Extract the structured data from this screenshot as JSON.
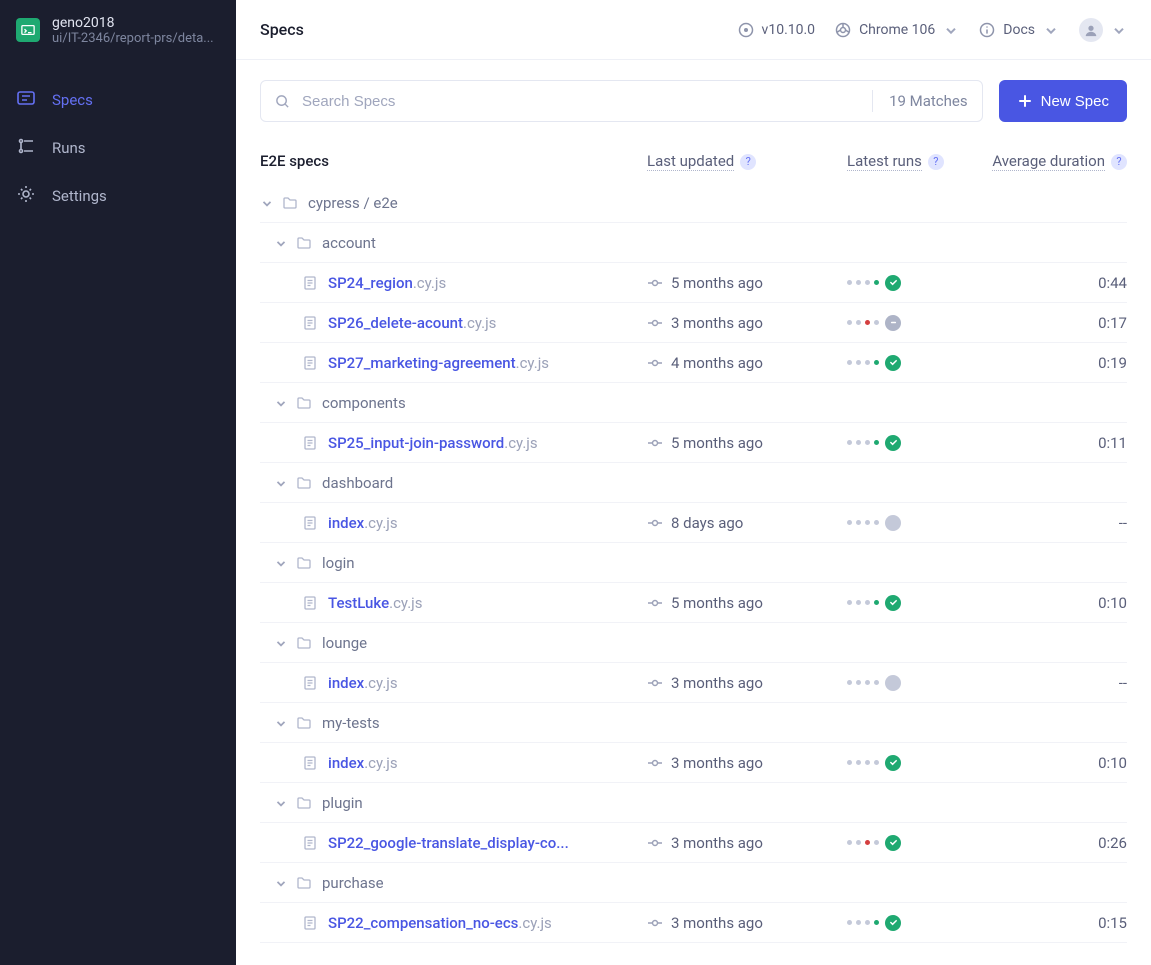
{
  "sidebar": {
    "project": "geno2018",
    "branch": "ui/IT-2346/report-prs/deta...",
    "items": [
      {
        "id": "specs",
        "label": "Specs",
        "icon": "specs-icon",
        "active": true
      },
      {
        "id": "runs",
        "label": "Runs",
        "icon": "runs-icon",
        "active": false
      },
      {
        "id": "settings",
        "label": "Settings",
        "icon": "gear-icon",
        "active": false
      }
    ]
  },
  "header": {
    "title": "Specs",
    "version": "v10.10.0",
    "browser": "Chrome 106",
    "docs": "Docs"
  },
  "toolbar": {
    "search_placeholder": "Search Specs",
    "matches": "19 Matches",
    "new_spec": "New Spec"
  },
  "columns": {
    "section": "E2E specs",
    "last_updated": "Last updated",
    "latest_runs": "Latest runs",
    "avg_duration": "Average duration"
  },
  "tree": [
    {
      "type": "folder",
      "level": 0,
      "name": "cypress / e2e"
    },
    {
      "type": "folder",
      "level": 1,
      "name": "account"
    },
    {
      "type": "file",
      "level": 2,
      "name": "SP24_region",
      "ext": ".cy.js",
      "updated": "5 months ago",
      "dots": [
        "gray",
        "gray",
        "gray",
        "green"
      ],
      "status": "pass",
      "duration": "0:44"
    },
    {
      "type": "file",
      "level": 2,
      "name": "SP26_delete-acount",
      "ext": ".cy.js",
      "updated": "3 months ago",
      "dots": [
        "gray",
        "gray",
        "red",
        "gray"
      ],
      "status": "skip",
      "duration": "0:17"
    },
    {
      "type": "file",
      "level": 2,
      "name": "SP27_marketing-agreement",
      "ext": ".cy.js",
      "updated": "4 months ago",
      "dots": [
        "gray",
        "gray",
        "gray",
        "green"
      ],
      "status": "pass",
      "duration": "0:19"
    },
    {
      "type": "folder",
      "level": 1,
      "name": "components"
    },
    {
      "type": "file",
      "level": 2,
      "name": "SP25_input-join-password",
      "ext": ".cy.js",
      "updated": "5 months ago",
      "dots": [
        "gray",
        "gray",
        "gray",
        "green"
      ],
      "status": "pass",
      "duration": "0:11"
    },
    {
      "type": "folder",
      "level": 1,
      "name": "dashboard"
    },
    {
      "type": "file",
      "level": 2,
      "name": "index",
      "ext": ".cy.js",
      "updated": "8 days ago",
      "dots": [
        "gray",
        "gray",
        "gray",
        "gray"
      ],
      "status": "pending",
      "duration": "--"
    },
    {
      "type": "folder",
      "level": 1,
      "name": "login"
    },
    {
      "type": "file",
      "level": 2,
      "name": "TestLuke",
      "ext": ".cy.js",
      "updated": "5 months ago",
      "dots": [
        "gray",
        "gray",
        "gray",
        "green"
      ],
      "status": "pass",
      "duration": "0:10"
    },
    {
      "type": "folder",
      "level": 1,
      "name": "lounge"
    },
    {
      "type": "file",
      "level": 2,
      "name": "index",
      "ext": ".cy.js",
      "updated": "3 months ago",
      "dots": [
        "gray",
        "gray",
        "gray",
        "gray"
      ],
      "status": "pending",
      "duration": "--"
    },
    {
      "type": "folder",
      "level": 1,
      "name": "my-tests"
    },
    {
      "type": "file",
      "level": 2,
      "name": "index",
      "ext": ".cy.js",
      "updated": "3 months ago",
      "dots": [
        "gray",
        "gray",
        "gray",
        "gray"
      ],
      "status": "pass",
      "duration": "0:10"
    },
    {
      "type": "folder",
      "level": 1,
      "name": "plugin"
    },
    {
      "type": "file",
      "level": 2,
      "name": "SP22_google-translate_display-co...",
      "ext": "",
      "updated": "3 months ago",
      "dots": [
        "gray",
        "gray",
        "red",
        "gray"
      ],
      "status": "pass",
      "duration": "0:26"
    },
    {
      "type": "folder",
      "level": 1,
      "name": "purchase"
    },
    {
      "type": "file",
      "level": 2,
      "name": "SP22_compensation_no-ecs",
      "ext": ".cy.js",
      "updated": "3 months ago",
      "dots": [
        "gray",
        "gray",
        "gray",
        "green"
      ],
      "status": "pass",
      "duration": "0:15"
    }
  ]
}
